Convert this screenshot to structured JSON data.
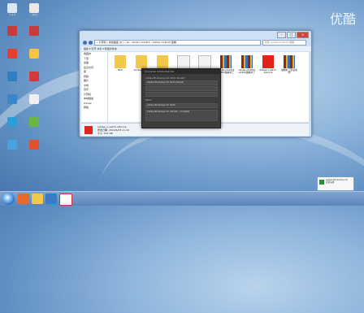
{
  "watermark": "优酷",
  "desktop_icons": [
    {
      "label": "计算机",
      "color": "#d8e6f5",
      "name": "computer-icon"
    },
    {
      "label": "回收站",
      "color": "#e9e9e9",
      "name": "recycle-bin-icon"
    },
    {
      "label": "",
      "color": "#c73b3b",
      "name": "adobe-icon"
    },
    {
      "label": "",
      "color": "#c73b3b",
      "name": "adobe-icon"
    },
    {
      "label": "",
      "color": "#e33e2e",
      "name": "pdf-icon"
    },
    {
      "label": "",
      "color": "#f4c63d",
      "name": "folder-icon"
    },
    {
      "label": "",
      "color": "#2d7fc1",
      "name": "app-icon"
    },
    {
      "label": "",
      "color": "#d13a3a",
      "name": "app-icon"
    },
    {
      "label": "",
      "color": "#3a86c8",
      "name": "app-icon"
    },
    {
      "label": "",
      "color": "#f0f0f0",
      "name": "document-icon"
    },
    {
      "label": "",
      "color": "#2e9cd6",
      "name": "app-icon"
    },
    {
      "label": "",
      "color": "#6cb543",
      "name": "app-icon"
    },
    {
      "label": "",
      "color": "#4aa0e0",
      "name": "app-icon"
    },
    {
      "label": "",
      "color": "#e44f2f",
      "name": "app-icon"
    }
  ],
  "explorer": {
    "path": "« 计算机 › 本地磁盘 (D:) › ae › Adobe CC2015 › Adobe CC2015 破解",
    "search_placeholder": "搜索 Adobe CC2015 破解",
    "toolbar_text": "组织 ▾   打开   共享 ▾   新建文件夹",
    "nav_items": [
      "收藏夹",
      "下载",
      "桌面",
      "最近访问",
      "库",
      "视频",
      "图片",
      "文档",
      "音乐",
      "计算机",
      "本地磁盘",
      "Adobe",
      "网络"
    ],
    "files": [
      {
        "name": "MAC",
        "type": "folder"
      },
      {
        "name": "photoshop cc",
        "type": "folder"
      },
      {
        "name": "WIN",
        "type": "folder"
      },
      {
        "name": "",
        "type": "document"
      },
      {
        "name": "Adobe CC 2015...",
        "type": "document"
      },
      {
        "name": "Adobe CC2015 amtlib破解补丁",
        "type": "archive"
      },
      {
        "name": "Adobe CC2015 amtlib破解补丁",
        "type": "archive"
      },
      {
        "name": "adobecc.patch.allinone",
        "type": "adobe"
      },
      {
        "name": "破解补丁安装说明",
        "type": "archive"
      }
    ],
    "details_name": "adobe.cc.patch.allinone",
    "details_line2": "修改日期: 2014/6/23 11:22",
    "details_line3": "大小: 647 KB"
  },
  "dialog": {
    "title": "Universal Adobe Patcher",
    "rows": [
      "Adobe Photoshop CC 2015 (64-bit)",
      "Patch",
      "Adobe Photoshop CC (64-bit) - complete"
    ],
    "field1": "Adobe Photoshop CC 2015 (64-bit)",
    "field2": "",
    "field3": "",
    "field4": "Adobe Photoshop CC 2015"
  },
  "notice": {
    "line1": "Adobe Photoshop CC",
    "line2": "安装完成"
  },
  "tray": {
    "time": "",
    "date": ""
  }
}
